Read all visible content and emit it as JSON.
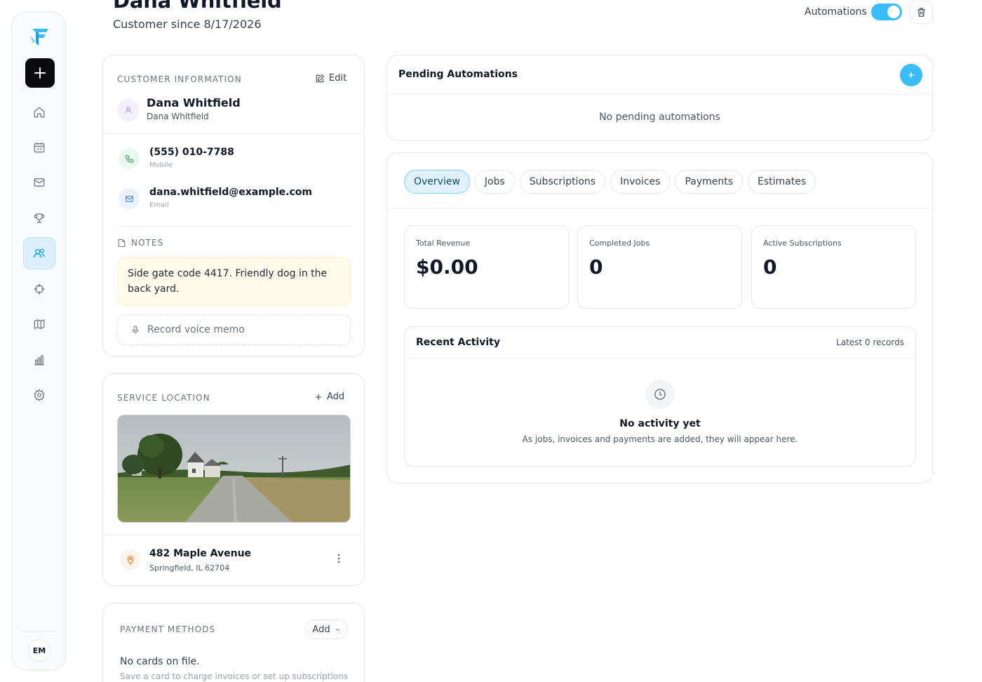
{
  "header": {
    "title": "Dana Whitfield",
    "customer_since": "Customer since 8/17/2026",
    "automations_label": "Automations"
  },
  "sidebar": {
    "avatar_initials": "EM",
    "active_item": "customers",
    "accent_color": "#38bdf8"
  },
  "customer_info": {
    "section_label": "CUSTOMER INFORMATION",
    "edit_label": "Edit",
    "name": "Dana Whitfield",
    "subname": "Dana Whitfield",
    "phone": "(555) 010-7788",
    "phone_type": "Mobile",
    "email": "dana.whitfield@example.com",
    "email_type": "Email",
    "notes_label": "NOTES",
    "note_text": "Side gate code 4417. Friendly dog in the back yard.",
    "voice_memo_label": "Record voice memo"
  },
  "service_location": {
    "section_label": "SERVICE LOCATION",
    "add_label": "Add",
    "address_line1": "482 Maple Avenue",
    "address_line2": "Springfield, IL 62704"
  },
  "payment_methods": {
    "section_label": "PAYMENT METHODS",
    "add_label": "Add",
    "empty_title": "No cards on file.",
    "empty_sub": "Save a card to charge invoices or set up subscriptions"
  },
  "pending_automations": {
    "title": "Pending Automations",
    "empty": "No pending automations"
  },
  "tabs": [
    {
      "label": "Overview"
    },
    {
      "label": "Jobs"
    },
    {
      "label": "Subscriptions"
    },
    {
      "label": "Invoices"
    },
    {
      "label": "Payments"
    },
    {
      "label": "Estimates"
    }
  ],
  "stats": [
    {
      "label": "Total Revenue",
      "value": "$0.00"
    },
    {
      "label": "Completed Jobs",
      "value": "0"
    },
    {
      "label": "Active Subscriptions",
      "value": "0"
    }
  ],
  "recent_activity": {
    "title": "Recent Activity",
    "count_label": "Latest 0 records",
    "empty_title": "No activity yet",
    "empty_sub": "As jobs, invoices and payments are added, they will appear here."
  }
}
